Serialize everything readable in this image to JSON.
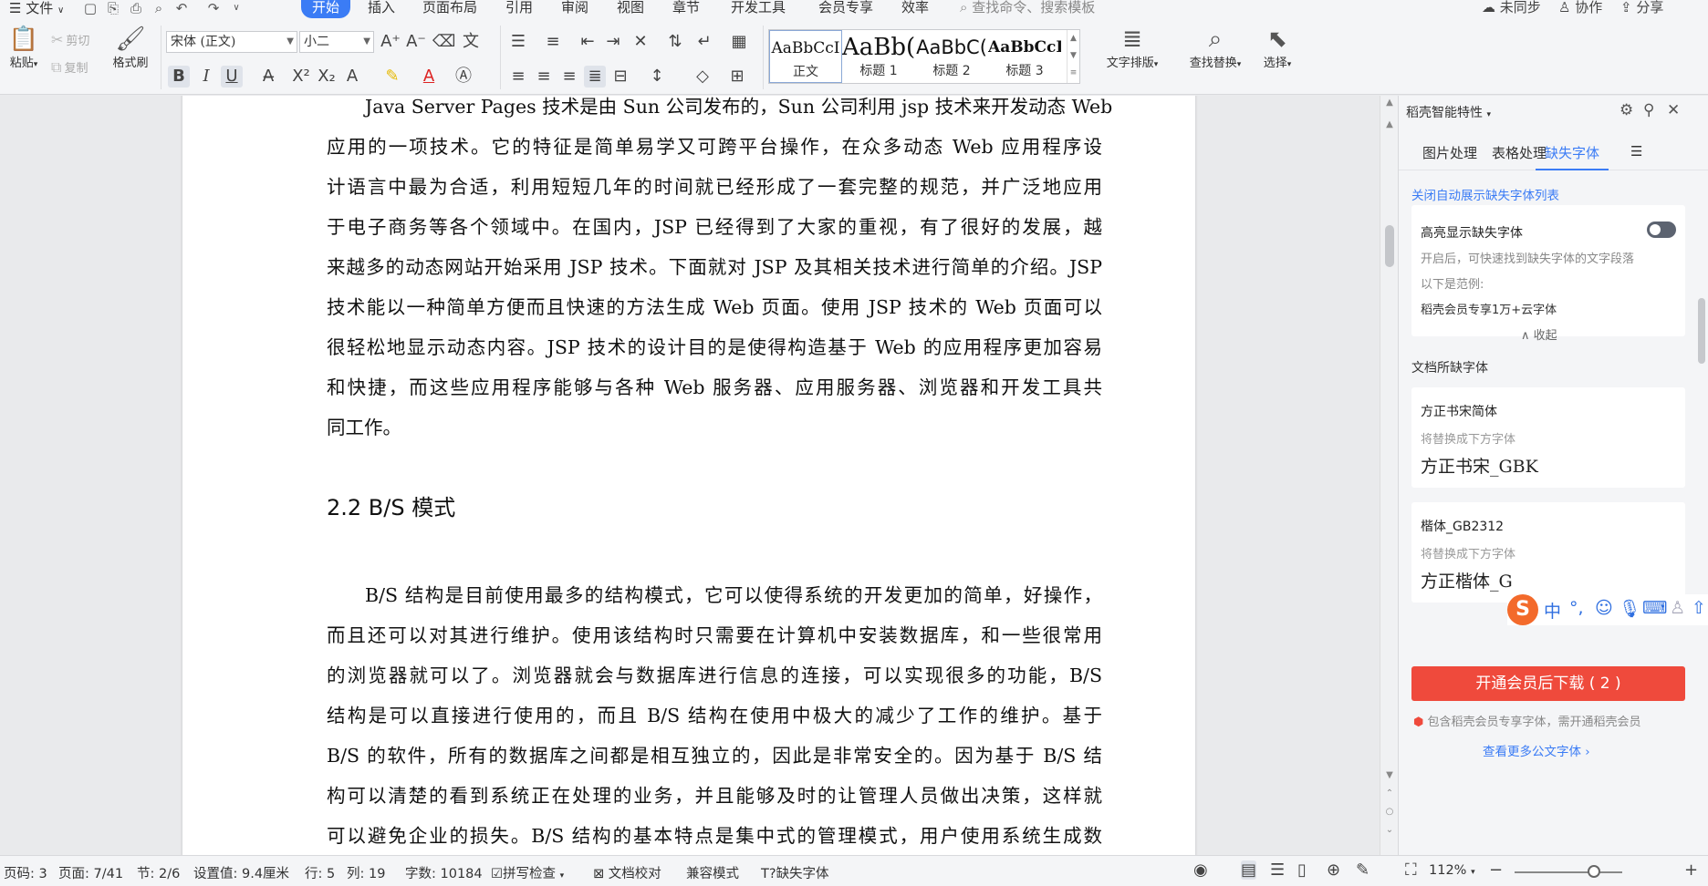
{
  "menubar": {
    "file": "文件",
    "tabs": [
      "开始",
      "插入",
      "页面布局",
      "引用",
      "审阅",
      "视图",
      "章节",
      "开发工具",
      "会员专享",
      "效率"
    ],
    "search_placeholder": "查找命令、搜索模板",
    "sync": "未同步",
    "collab": "协作",
    "share": "分享"
  },
  "ribbon": {
    "paste": "粘贴",
    "cut": "剪切",
    "copy": "复制",
    "format_painter": "格式刷",
    "font_name": "宋体 (正文)",
    "font_size": "小二",
    "styles": [
      {
        "preview": "AaBbCcI",
        "label": "正文"
      },
      {
        "preview": "AaBb(",
        "label": "标题 1"
      },
      {
        "preview": "AaBbC(",
        "label": "标题 2"
      },
      {
        "preview": "AaBbCcI",
        "label": "标题 3"
      }
    ],
    "text_layout": "文字排版",
    "find_replace": "查找替换",
    "select": "选择"
  },
  "document": {
    "para1": [
      "Java Server Pages 技术是由 Sun 公司发布的，Sun 公司利用 jsp 技术来开发动态 Web",
      "应用的一项技术。它的特征是简单易学又可跨平台操作，在众多动态 Web 应用程序设",
      "计语言中最为合适，利用短短几年的时间就已经形成了一套完整的规范，并广泛地应用",
      "于电子商务等各个领域中。在国内，JSP 已经得到了大家的重视，有了很好的发展，越",
      "来越多的动态网站开始采用 JSP 技术。下面就对 JSP 及其相关技术进行简单的介绍。JSP",
      "技术能以一种简单方便而且快速的方法生成 Web 页面。使用 JSP 技术的 Web 页面可以",
      "很轻松地显示动态内容。JSP 技术的设计目的是使得构造基于 Web 的应用程序更加容易",
      "和快捷，而这些应用程序能够与各种 Web 服务器、应用服务器、浏览器和开发工具共",
      "同工作。"
    ],
    "heading": "2.2  B/S 模式",
    "para2": [
      "B/S 结构是目前使用最多的结构模式，它可以使得系统的开发更加的简单，好操作，",
      "而且还可以对其进行维护。使用该结构时只需要在计算机中安装数据库，和一些很常用",
      "的浏览器就可以了。浏览器就会与数据库进行信息的连接，可以实现很多的功能，B/S",
      "结构是可以直接进行使用的，而且 B/S 结构在使用中极大的减少了工作的维护。基于",
      "B/S 的软件，所有的数据库之间都是相互独立的，因此是非常安全的。因为基于 B/S 结",
      "构可以清楚的看到系统正在处理的业务，并且能够及时的让管理人员做出决策，这样就",
      "可以避免企业的损失。B/S 结构的基本特点是集中式的管理模式，用户使用系统生成数"
    ]
  },
  "side_panel": {
    "title": "稻壳智能特性",
    "tabs": [
      "图片处理",
      "表格处理",
      "缺失字体"
    ],
    "close_auto_list": "关闭自动展示缺失字体列表",
    "highlight_title": "高亮显示缺失字体",
    "highlight_desc": "开启后，可快速找到缺失字体的文字段落",
    "example_label": "以下是范例:",
    "example_value": "稻壳会员专享1万+云字体",
    "collapse": "收起",
    "missing_title": "文档所缺字体",
    "fonts": [
      {
        "name": "方正书宋简体",
        "replace_label": "将替换成下方字体",
        "replacement": "方正书宋_GBK"
      },
      {
        "name": "楷体_GB2312",
        "replace_label": "将替换成下方字体",
        "replacement": "方正楷体_G"
      }
    ],
    "download_button": "开通会员后下载 ( 2 )",
    "member_note": "包含稻壳会员专享字体，需开通稻壳会员",
    "more_fonts": "查看更多公文字体"
  },
  "ime": {
    "logo": "S",
    "lang": "中"
  },
  "statusbar": {
    "page_code": "页码: 3",
    "page": "页面: 7/41",
    "section": "节: 2/6",
    "setting": "设置值: 9.4厘米",
    "row": "行: 5",
    "col": "列: 19",
    "word_count": "字数: 10184",
    "spell_check": "拼写检查",
    "doc_proof": "文档校对",
    "compat_mode": "兼容模式",
    "missing_fonts": "缺失字体",
    "zoom": "112%"
  }
}
